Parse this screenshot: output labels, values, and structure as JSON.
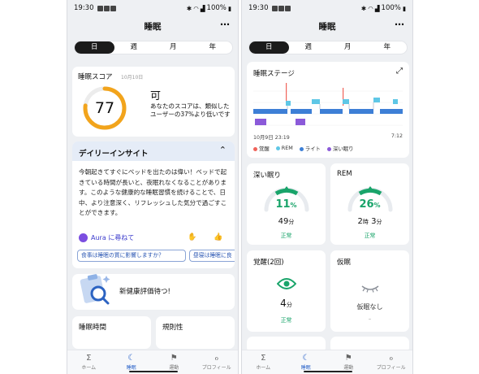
{
  "left": {
    "status": {
      "time": "19:30",
      "battery": "100%"
    },
    "header": {
      "title": "睡眠",
      "more": "⋯"
    },
    "tabs": [
      "日",
      "週",
      "月",
      "年"
    ],
    "score": {
      "title": "睡眠スコア",
      "date": "10月10日",
      "value": "77",
      "grade": "可",
      "description": "あなたのスコアは、類似したユーザーの37%より低いです",
      "ring_fraction": 0.77,
      "ring_color": "#f2a41c"
    },
    "insight": {
      "title": "デイリーインサイト",
      "body": "今朝起きてすぐにベッドを出たのは偉い！ベッドで起きている時間が長いと、夜眠れなくなることがあります。このような健康的な睡眠習慣を続けることで、日中、より注意深く、リフレッシュした気分で過ごすことができます。",
      "aura_label": "Aura に尋ねて",
      "chips": [
        "食事は睡眠の質に影響しますか？",
        "昼寝は睡眠に良"
      ]
    },
    "banner": {
      "text": "新健康評価待つ!"
    },
    "small_cards": [
      "睡眠時間",
      "規則性"
    ],
    "nav": [
      {
        "label": "ホーム",
        "icon": "Σ"
      },
      {
        "label": "睡眠",
        "icon": "☾"
      },
      {
        "label": "運動",
        "icon": "⚑"
      },
      {
        "label": "プロフィール",
        "icon": "ℴ"
      }
    ]
  },
  "right": {
    "status": {
      "time": "19:30",
      "battery": "100%"
    },
    "header": {
      "title": "睡眠",
      "more": "⋯"
    },
    "tabs": [
      "日",
      "週",
      "月",
      "年"
    ],
    "stage": {
      "title": "睡眠ステージ",
      "start_time": "10月9日 23:19",
      "end_time": "7:12",
      "legend": [
        {
          "label": "覚醒",
          "color": "#f0635a"
        },
        {
          "label": "REM",
          "color": "#5fc7e6"
        },
        {
          "label": "ライト",
          "color": "#3d7fd6"
        },
        {
          "label": "深い眠り",
          "color": "#8b5ad9"
        }
      ]
    },
    "deep": {
      "title": "深い眠り",
      "percent": "11",
      "pct_sign": "%",
      "minutes": "49",
      "min_unit": "分",
      "status": "正常",
      "fraction": 0.11
    },
    "rem": {
      "title": "REM",
      "percent": "26",
      "pct_sign": "%",
      "hours": "2",
      "hour_unit": "時",
      "minutes": "3",
      "min_unit": "分",
      "status": "正常",
      "fraction": 0.26
    },
    "wake": {
      "title": "覚醒(2回)",
      "minutes": "4",
      "min_unit": "分",
      "status": "正常"
    },
    "nap": {
      "title": "仮眠",
      "text": "仮眠なし",
      "dash": "–"
    },
    "nav": [
      {
        "label": "ホーム",
        "icon": "Σ"
      },
      {
        "label": "睡眠",
        "icon": "☾"
      },
      {
        "label": "運動",
        "icon": "⚑"
      },
      {
        "label": "プロフィール",
        "icon": "ℴ"
      }
    ]
  }
}
